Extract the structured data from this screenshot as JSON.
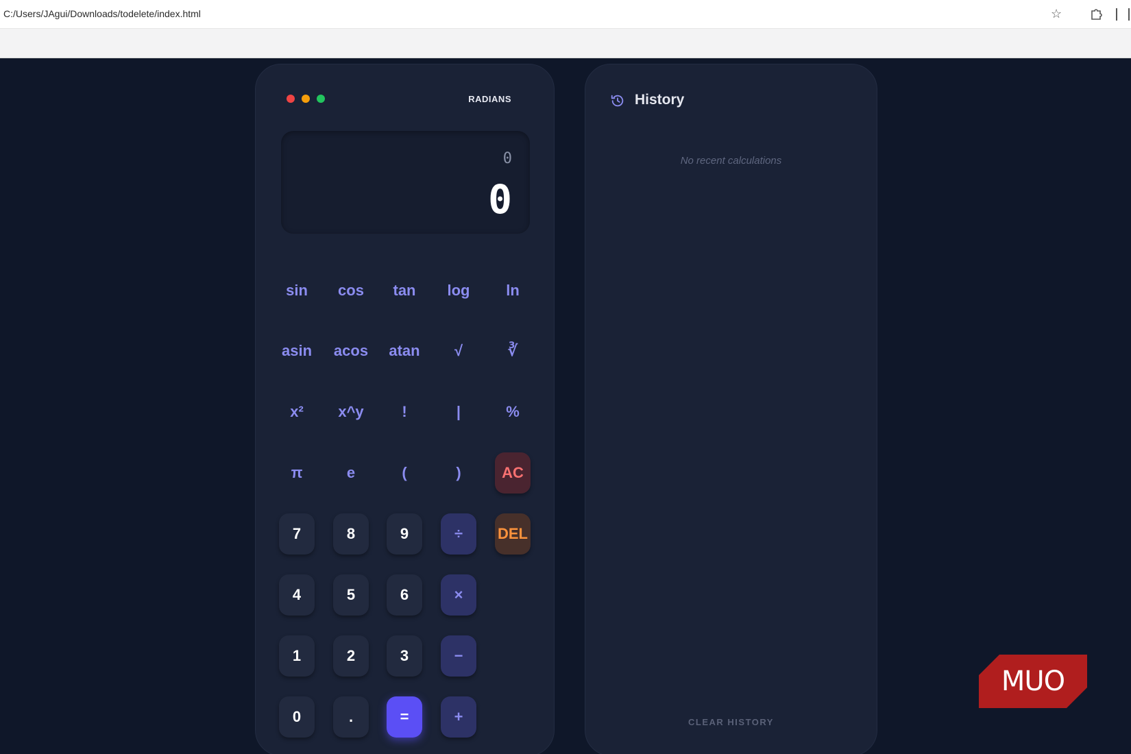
{
  "browser": {
    "url": "C:/Users/JAgui/Downloads/todelete/index.html"
  },
  "calculator": {
    "mode": "RADIANS",
    "display": {
      "expression": "0",
      "result": "0"
    },
    "keys": [
      {
        "label": "sin",
        "kind": "fn",
        "row": 0,
        "col": 0,
        "name": "sin-button"
      },
      {
        "label": "cos",
        "kind": "fn",
        "row": 0,
        "col": 1,
        "name": "cos-button"
      },
      {
        "label": "tan",
        "kind": "fn",
        "row": 0,
        "col": 2,
        "name": "tan-button"
      },
      {
        "label": "log",
        "kind": "fn",
        "row": 0,
        "col": 3,
        "name": "log-button"
      },
      {
        "label": "ln",
        "kind": "fn",
        "row": 0,
        "col": 4,
        "name": "ln-button"
      },
      {
        "label": "asin",
        "kind": "fn",
        "row": 1,
        "col": 0,
        "name": "asin-button"
      },
      {
        "label": "acos",
        "kind": "fn",
        "row": 1,
        "col": 1,
        "name": "acos-button"
      },
      {
        "label": "atan",
        "kind": "fn",
        "row": 1,
        "col": 2,
        "name": "atan-button"
      },
      {
        "label": "√",
        "kind": "fn",
        "row": 1,
        "col": 3,
        "name": "sqrt-button"
      },
      {
        "label": "∛",
        "kind": "fn",
        "row": 1,
        "col": 4,
        "name": "cbrt-button"
      },
      {
        "label": "x²",
        "kind": "fn",
        "row": 2,
        "col": 0,
        "name": "square-button"
      },
      {
        "label": "x^y",
        "kind": "fn",
        "row": 2,
        "col": 1,
        "name": "power-button"
      },
      {
        "label": "!",
        "kind": "fn",
        "row": 2,
        "col": 2,
        "name": "factorial-button"
      },
      {
        "label": "|",
        "kind": "fn",
        "row": 2,
        "col": 3,
        "name": "abs-button"
      },
      {
        "label": "%",
        "kind": "fn",
        "row": 2,
        "col": 4,
        "name": "percent-button"
      },
      {
        "label": "π",
        "kind": "fn",
        "row": 3,
        "col": 0,
        "name": "pi-button"
      },
      {
        "label": "e",
        "kind": "fn",
        "row": 3,
        "col": 1,
        "name": "euler-button"
      },
      {
        "label": "(",
        "kind": "fn",
        "row": 3,
        "col": 2,
        "name": "open-paren-button"
      },
      {
        "label": ")",
        "kind": "fn",
        "row": 3,
        "col": 3,
        "name": "close-paren-button"
      },
      {
        "label": "AC",
        "kind": "ac",
        "row": 3,
        "col": 4,
        "name": "all-clear-button"
      },
      {
        "label": "7",
        "kind": "num",
        "row": 4,
        "col": 0,
        "name": "digit-7-button"
      },
      {
        "label": "8",
        "kind": "num",
        "row": 4,
        "col": 1,
        "name": "digit-8-button"
      },
      {
        "label": "9",
        "kind": "num",
        "row": 4,
        "col": 2,
        "name": "digit-9-button"
      },
      {
        "label": "÷",
        "kind": "op",
        "row": 4,
        "col": 3,
        "name": "divide-button"
      },
      {
        "label": "DEL",
        "kind": "del",
        "row": 4,
        "col": 4,
        "name": "delete-button"
      },
      {
        "label": "4",
        "kind": "num",
        "row": 5,
        "col": 0,
        "name": "digit-4-button"
      },
      {
        "label": "5",
        "kind": "num",
        "row": 5,
        "col": 1,
        "name": "digit-5-button"
      },
      {
        "label": "6",
        "kind": "num",
        "row": 5,
        "col": 2,
        "name": "digit-6-button"
      },
      {
        "label": "×",
        "kind": "op",
        "row": 5,
        "col": 3,
        "name": "multiply-button"
      },
      {
        "label": "1",
        "kind": "num",
        "row": 6,
        "col": 0,
        "name": "digit-1-button"
      },
      {
        "label": "2",
        "kind": "num",
        "row": 6,
        "col": 1,
        "name": "digit-2-button"
      },
      {
        "label": "3",
        "kind": "num",
        "row": 6,
        "col": 2,
        "name": "digit-3-button"
      },
      {
        "label": "−",
        "kind": "op",
        "row": 6,
        "col": 3,
        "name": "subtract-button"
      },
      {
        "label": "0",
        "kind": "num",
        "row": 7,
        "col": 0,
        "name": "digit-0-button"
      },
      {
        "label": ".",
        "kind": "num",
        "row": 7,
        "col": 1,
        "name": "decimal-button"
      },
      {
        "label": "=",
        "kind": "eq",
        "row": 7,
        "col": 2,
        "name": "equals-button"
      },
      {
        "label": "+",
        "kind": "op",
        "row": 7,
        "col": 3,
        "name": "add-button"
      }
    ]
  },
  "history": {
    "title": "History",
    "icon": "history-icon",
    "empty_text": "No recent calculations",
    "clear_label": "CLEAR HISTORY"
  },
  "watermark": {
    "text": "MUO"
  },
  "colors": {
    "accent": "#5b4ff5",
    "function_text": "#8b8cf0",
    "clear_text": "#f87171",
    "delete_text": "#fb923c"
  }
}
